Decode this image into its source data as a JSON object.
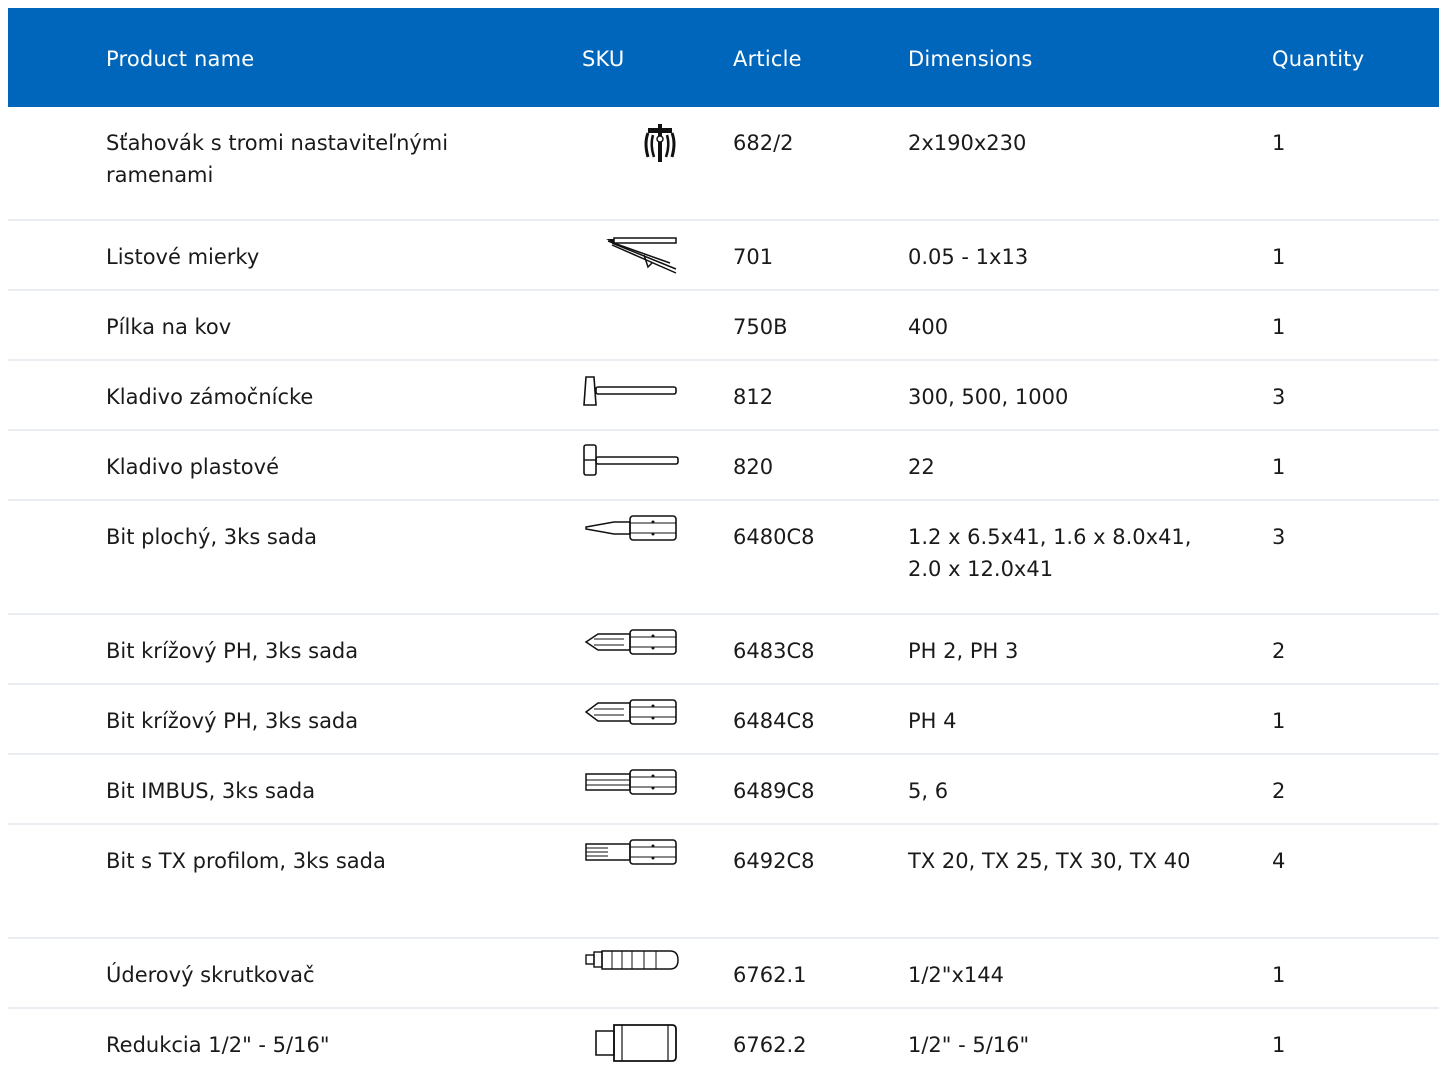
{
  "headers": {
    "product": "Product name",
    "sku": "SKU",
    "article": "Article",
    "dimensions": "Dimensions",
    "quantity": "Quantity"
  },
  "rows": [
    {
      "name": "Sťahovák s tromi nastaviteľnými ramenami",
      "icon": "gear-puller-icon",
      "article": "682/2",
      "dimensions": "2x190x230",
      "quantity": "1"
    },
    {
      "name": "Listové mierky",
      "icon": "feeler-gauge-icon",
      "article": "701",
      "dimensions": "0.05 - 1x13",
      "quantity": "1"
    },
    {
      "name": "Pílka na kov",
      "icon": "",
      "article": "750B",
      "dimensions": "400",
      "quantity": "1"
    },
    {
      "name": "Kladivo zámočnícke",
      "icon": "locksmith-hammer-icon",
      "article": "812",
      "dimensions": "300, 500, 1000",
      "quantity": "3"
    },
    {
      "name": "Kladivo plastové",
      "icon": "plastic-hammer-icon",
      "article": "820",
      "dimensions": "22",
      "quantity": "1"
    },
    {
      "name": "Bit plochý, 3ks sada",
      "icon": "flat-bit-icon",
      "article": "6480C8",
      "dimensions": "1.2 x 6.5x41, 1.6 x 8.0x41, 2.0 x 12.0x41",
      "quantity": "3"
    },
    {
      "name": "Bit krížový PH, 3ks sada",
      "icon": "phillips-bit-icon",
      "article": "6483C8",
      "dimensions": "PH 2, PH 3",
      "quantity": "2"
    },
    {
      "name": "Bit krížový PH, 3ks sada",
      "icon": "phillips-bit-icon",
      "article": "6484C8",
      "dimensions": "PH 4",
      "quantity": "1"
    },
    {
      "name": "Bit IMBUS, 3ks sada",
      "icon": "hex-bit-icon",
      "article": "6489C8",
      "dimensions": "5, 6",
      "quantity": "2"
    },
    {
      "name": "Bit s TX profilom, 3ks sada",
      "icon": "torx-bit-icon",
      "article": "6492C8",
      "dimensions": "TX 20, TX 25, TX 30, TX 40",
      "quantity": "4"
    },
    {
      "name": "Úderový skrutkovač",
      "icon": "impact-driver-icon",
      "article": "6762.1",
      "dimensions": "1/2\"x144",
      "quantity": "1"
    },
    {
      "name": "Redukcia 1/2\" - 5/16\"",
      "icon": "socket-adapter-icon",
      "article": "6762.2",
      "dimensions": "1/2\" - 5/16\"",
      "quantity": "1"
    }
  ]
}
